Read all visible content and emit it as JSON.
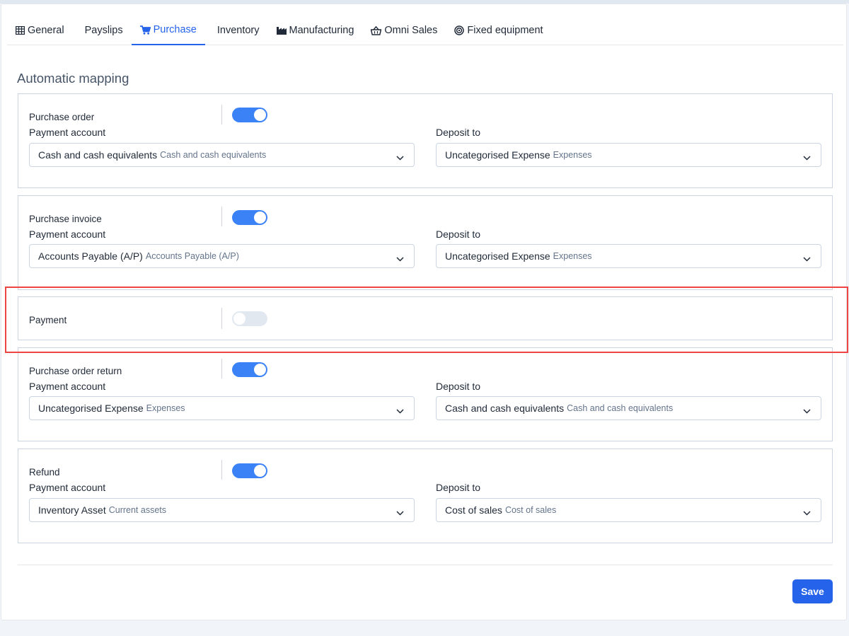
{
  "tabs": [
    {
      "label": "General",
      "icon": "table-icon"
    },
    {
      "label": "Payslips",
      "icon": ""
    },
    {
      "label": "Purchase",
      "icon": "cart-icon"
    },
    {
      "label": "Inventory",
      "icon": ""
    },
    {
      "label": "Manufacturing",
      "icon": "factory-icon"
    },
    {
      "label": "Omni Sales",
      "icon": "basket-icon"
    },
    {
      "label": "Fixed equipment",
      "icon": "target-icon"
    }
  ],
  "active_tab": "Purchase",
  "heading": "Automatic mapping",
  "sections": {
    "purchase_order": {
      "title": "Purchase order",
      "enabled": true,
      "payment_label": "Payment account",
      "payment_main": "Cash and cash equivalents",
      "payment_sub": "Cash and cash equivalents",
      "deposit_label": "Deposit to",
      "deposit_main": "Uncategorised Expense",
      "deposit_sub": "Expenses"
    },
    "purchase_invoice": {
      "title": "Purchase invoice",
      "enabled": true,
      "payment_label": "Payment account",
      "payment_main": "Accounts Payable (A/P)",
      "payment_sub": "Accounts Payable (A/P)",
      "deposit_label": "Deposit to",
      "deposit_main": "Uncategorised Expense",
      "deposit_sub": "Expenses"
    },
    "payment": {
      "title": "Payment",
      "enabled": false
    },
    "purchase_order_return": {
      "title": "Purchase order return",
      "enabled": true,
      "payment_label": "Payment account",
      "payment_main": "Uncategorised Expense",
      "payment_sub": "Expenses",
      "deposit_label": "Deposit to",
      "deposit_main": "Cash and cash equivalents",
      "deposit_sub": "Cash and cash equivalents"
    },
    "refund": {
      "title": "Refund",
      "enabled": true,
      "payment_label": "Payment account",
      "payment_main": "Inventory Asset",
      "payment_sub": "Current assets",
      "deposit_label": "Deposit to",
      "deposit_main": "Cost of sales",
      "deposit_sub": "Cost of sales"
    }
  },
  "save_label": "Save",
  "colors": {
    "accent": "#2563eb",
    "toggle_on": "#3b82f6",
    "highlight": "#ef4444"
  }
}
